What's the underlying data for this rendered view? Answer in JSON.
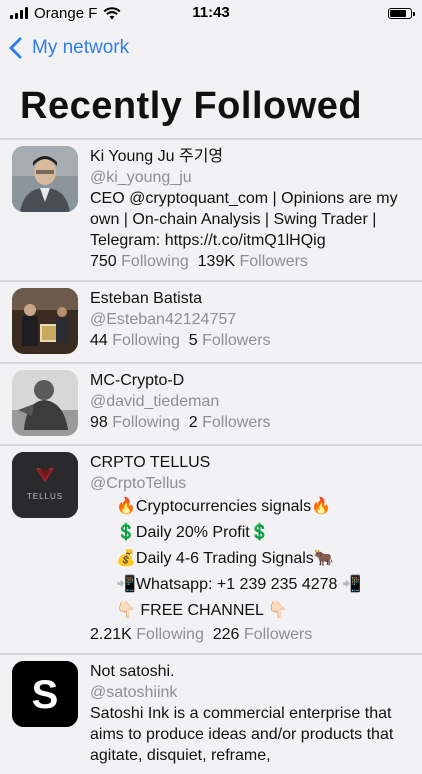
{
  "status": {
    "carrier": "Orange F",
    "time": "11:43",
    "battery_level": 0.85
  },
  "nav": {
    "back_label": "My network"
  },
  "page": {
    "title": "Recently Followed"
  },
  "users": [
    {
      "name": "Ki Young Ju 주기영",
      "handle": "@ki_young_ju",
      "bio": "CEO @cryptoquant_com | Opinions are my own | On-chain Analysis | Swing Trader | Telegram: https://t.co/itmQ1lHQig",
      "following": "750",
      "following_label": "Following",
      "followers": "139K",
      "followers_label": "Followers"
    },
    {
      "name": "Esteban Batista",
      "handle": "@Esteban42124757",
      "following": "44",
      "following_label": "Following",
      "followers": "5",
      "followers_label": "Followers"
    },
    {
      "name": "MC-Crypto-D",
      "handle": "@david_tiedeman",
      "following": "98",
      "following_label": "Following",
      "followers": "2",
      "followers_label": "Followers"
    },
    {
      "name": "CRPTO TELLUS",
      "handle": "@CrptoTellus",
      "avatar_text": "TELLUS",
      "bio_lines": [
        "🔥Cryptocurrencies signals🔥",
        "💲Daily 20% Profit💲",
        "💰Daily 4-6 Trading Signals🐂",
        "📲Whatsapp: +1 239 235 4278 📲",
        "👇🏻 FREE CHANNEL 👇🏻"
      ],
      "following": "2.21K",
      "following_label": "Following",
      "followers": "226",
      "followers_label": "Followers"
    },
    {
      "name": "Not satoshi.",
      "handle": "@satoshiink",
      "avatar_text": "S",
      "bio": "Satoshi Ink is a commercial enterprise that aims to produce ideas and/or products that agitate, disquiet, reframe,"
    }
  ],
  "colors": {
    "accent": "#2f7fe4",
    "secondary_text": "#8e8e93",
    "separator": "#d7d7da",
    "background": "#f2f2f4"
  }
}
